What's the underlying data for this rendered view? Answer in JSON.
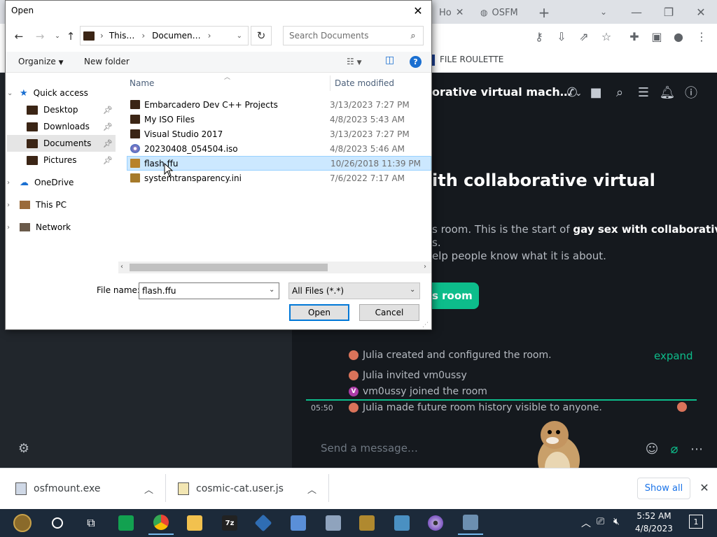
{
  "browser": {
    "tabs": [
      {
        "label": "Ho"
      },
      {
        "label": "OSFM"
      }
    ],
    "new_tab": "+",
    "bookmark": "FILE ROULETTE",
    "window_controls": {
      "minimize": "—",
      "restore": "❐",
      "close": "✕"
    }
  },
  "room": {
    "title": "orative virtual mach…",
    "big_title": "ith collaborative virtual",
    "intro_line1_plain": "s room. This is the start of ",
    "intro_line1_bold": "gay sex with collaborative",
    "intro_line2": "s.",
    "intro_line3": "elp people know what it is about.",
    "invite_label": "s room",
    "events": [
      {
        "avatar": "",
        "text": "Julia created and configured the room."
      },
      {
        "avatar": "",
        "text": "Julia invited vm0ussy"
      },
      {
        "avatar": "V",
        "text": "vm0ussy joined the room"
      },
      {
        "avatar": "",
        "text": "Julia made future room history visible to anyone."
      }
    ],
    "expand": "expand",
    "time": "05:50",
    "composer_placeholder": "Send a message…"
  },
  "downloads": {
    "items": [
      {
        "name": "osfmount.exe"
      },
      {
        "name": "cosmic-cat.user.js"
      }
    ],
    "show_all": "Show all"
  },
  "taskbar": {
    "time": "5:52 AM",
    "date": "4/8/2023",
    "notification_count": "1"
  },
  "dialog": {
    "title": "Open",
    "breadcrumb": [
      "This…",
      "Documen…"
    ],
    "search_placeholder": "Search Documents",
    "organize": "Organize",
    "new_folder": "New folder",
    "nav": [
      {
        "label": "Quick access",
        "pinned": false
      },
      {
        "label": "Desktop",
        "pinned": true
      },
      {
        "label": "Downloads",
        "pinned": true
      },
      {
        "label": "Documents",
        "pinned": true
      },
      {
        "label": "Pictures",
        "pinned": true
      },
      {
        "label": "OneDrive",
        "pinned": false
      },
      {
        "label": "This PC",
        "pinned": false
      },
      {
        "label": "Network",
        "pinned": false
      }
    ],
    "columns": {
      "name": "Name",
      "date": "Date modified"
    },
    "files": [
      {
        "name": "Embarcadero Dev C++ Projects",
        "date": "3/13/2023 7:27 PM",
        "type": "folder"
      },
      {
        "name": "My ISO Files",
        "date": "4/8/2023 5:43 AM",
        "type": "folder"
      },
      {
        "name": "Visual Studio 2017",
        "date": "3/13/2023 7:27 PM",
        "type": "folder"
      },
      {
        "name": "20230408_054504.iso",
        "date": "4/8/2023 5:46 AM",
        "type": "iso"
      },
      {
        "name": "flash.ffu",
        "date": "10/26/2018 11:39 PM",
        "type": "file"
      },
      {
        "name": "systemtransparency.ini",
        "date": "7/6/2022 7:17 AM",
        "type": "ini"
      }
    ],
    "file_name_label": "File name:",
    "file_name_value": "flash.ffu",
    "filter": "All Files (*.*)",
    "open": "Open",
    "cancel": "Cancel"
  },
  "colors": {
    "accent_green": "#0dbd8b",
    "selection_blue": "#cce8ff",
    "win_blue": "#0078d7"
  }
}
